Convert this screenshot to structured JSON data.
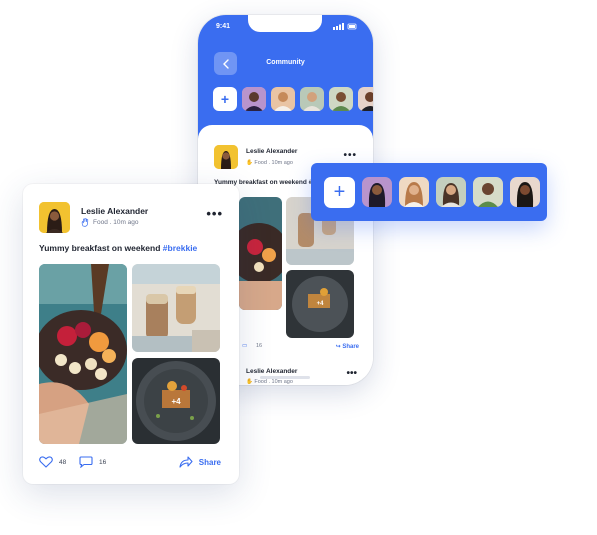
{
  "phone": {
    "status_time": "9:41",
    "title": "Community",
    "post": {
      "author": "Leslie Alexander",
      "meta": "Food . 10m ago",
      "caption": "Yummy breakfast on weekend #brekkie",
      "comments": "16",
      "share_label": "Share",
      "more_count": "+4"
    },
    "next_post": {
      "author": "Leslie Alexander",
      "meta": "Food . 10m ago"
    }
  },
  "card": {
    "author": "Leslie Alexander",
    "meta": "Food . 10m ago",
    "caption_text": "Yummy breakfast on weekend ",
    "caption_tag": "#brekkie",
    "likes": "48",
    "comments": "16",
    "share_label": "Share",
    "more_count": "+4"
  },
  "colors": {
    "accent": "#3a6df0",
    "avatar_bg": "#f2c230"
  }
}
